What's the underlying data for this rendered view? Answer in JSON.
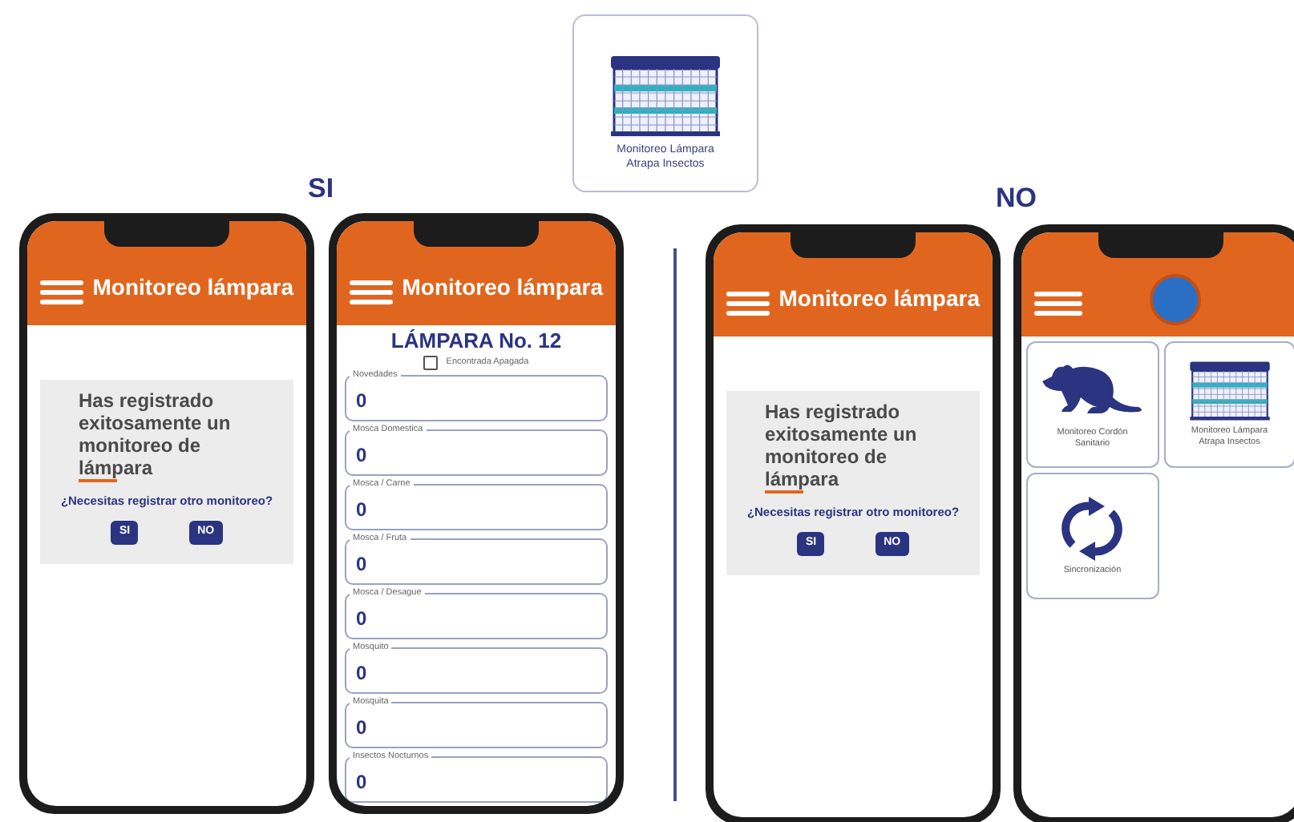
{
  "top_card": {
    "label": "Monitoreo Lámpara Atrapa Insectos"
  },
  "branches": [
    {
      "label": "SI"
    },
    {
      "label": "NO"
    }
  ],
  "phones": [
    {
      "kind": "confirm",
      "title": "Monitoreo lámpara",
      "message": "Has registrado exitosamente un monitoreo de lámpara",
      "question": "¿Necesitas registrar otro monitoreo?",
      "buttons": [
        "SI",
        "NO"
      ]
    },
    {
      "kind": "form",
      "title": "Monitoreo lámpara",
      "heading": "LÁMPARA No. 12",
      "checkbox": {
        "label": "Encontrada Apagada",
        "checked": false
      },
      "fields": [
        {
          "label": "Novedades",
          "value": "0"
        },
        {
          "label": "Mosca Domestica",
          "value": "0"
        },
        {
          "label": "Mosca / Carne",
          "value": "0"
        },
        {
          "label": "Mosca / Fruta",
          "value": "0"
        },
        {
          "label": "Mosca / Desague",
          "value": "0"
        },
        {
          "label": "Mosquito",
          "value": "0"
        },
        {
          "label": "Mosquita",
          "value": "0"
        },
        {
          "label": "Insectos Nocturnos",
          "value": "0"
        }
      ]
    },
    {
      "kind": "confirm",
      "title": "Monitoreo lámpara",
      "message": "Has registrado exitosamente un monitoreo de lámpara",
      "question": "¿Necesitas registrar otro monitoreo?",
      "buttons": [
        "SI",
        "NO"
      ]
    },
    {
      "kind": "menu",
      "tiles": [
        {
          "kind": "rat",
          "label": "Monitoreo Cordón Sanitario"
        },
        {
          "kind": "lamp",
          "label": "Monitoreo Lámpara Atrapa Insectos"
        },
        {
          "kind": "sync",
          "label": "Sincronización"
        }
      ]
    }
  ]
}
